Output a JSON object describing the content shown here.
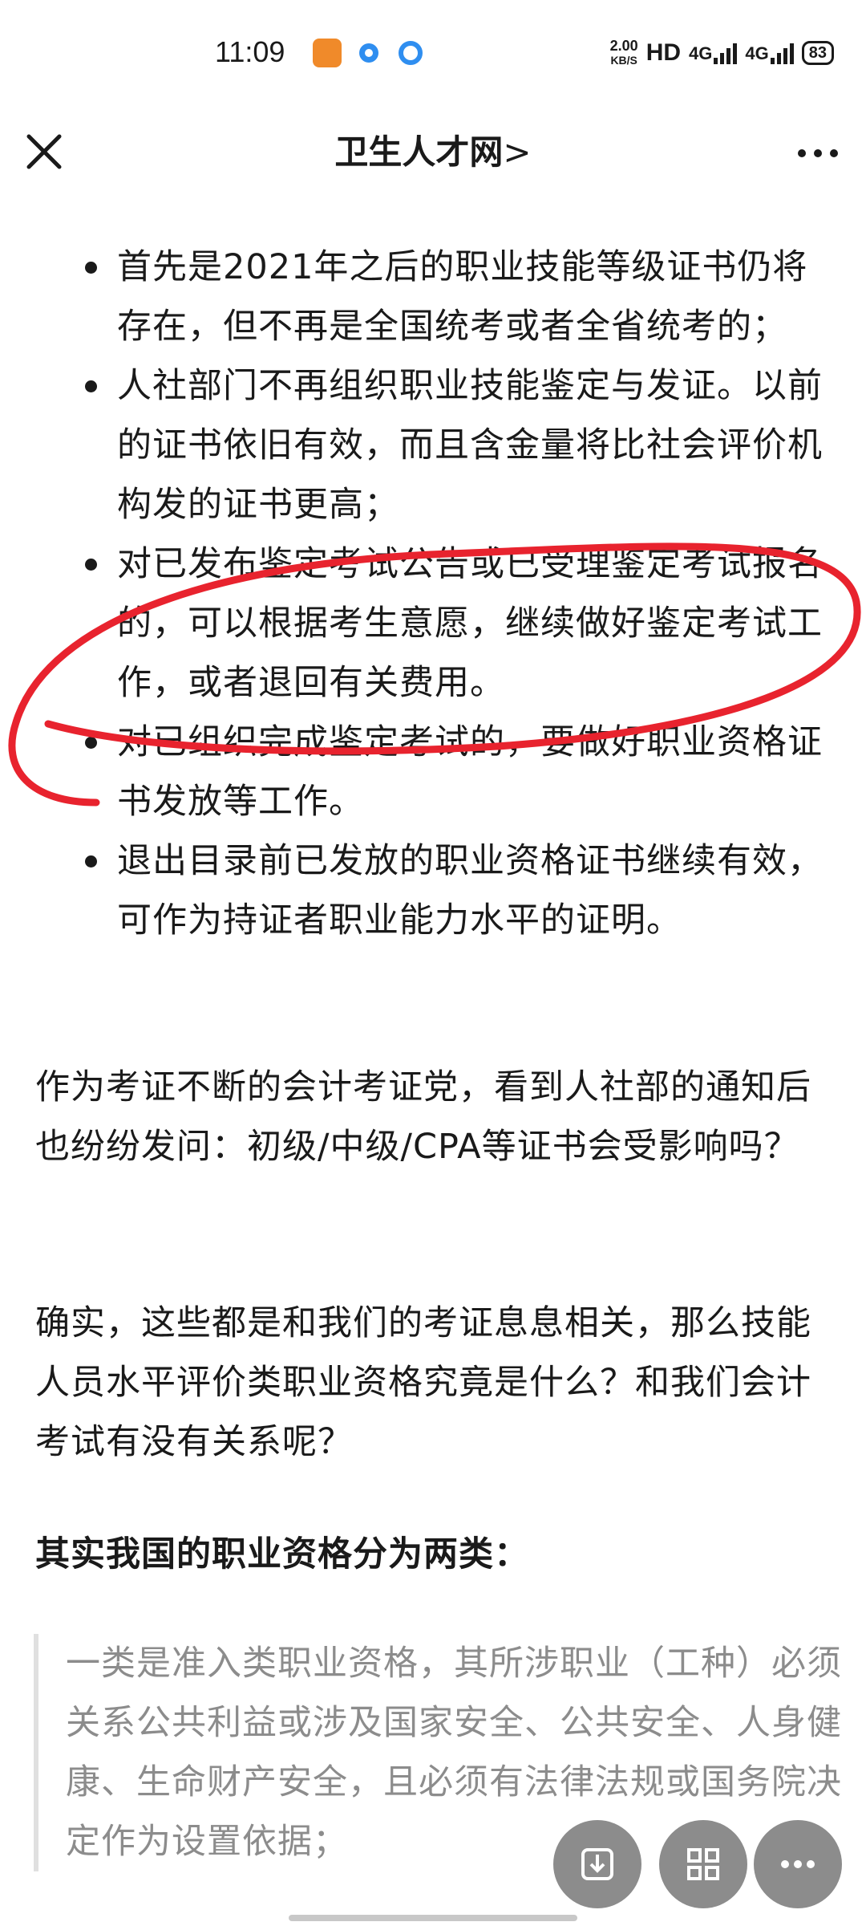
{
  "status_bar": {
    "time": "11:09",
    "net_speed_value": "2.00",
    "net_speed_unit": "KB/S",
    "hd_label": "HD",
    "signal1_label": "4G",
    "signal2_label": "4G",
    "battery": "83",
    "app_icons": [
      "uc-browser-icon",
      "blue-dot-icon",
      "qq-browser-icon"
    ]
  },
  "nav": {
    "title": "卫生人才网",
    "chevron": ">"
  },
  "article": {
    "bullets": [
      "首先是2021年之后的职业技能等级证书仍将存在，但不再是全国统考或者全省统考的；",
      "人社部门不再组织职业技能鉴定与发证。以前的证书依旧有效，而且含金量将比社会评价机构发的证书更高；",
      "对已发布鉴定考试公告或已受理鉴定考试报名的，可以根据考生意愿，继续做好鉴定考试工作，或者退回有关费用。",
      "对已组织完成鉴定考试的，要做好职业资格证书发放等工作。",
      "退出目录前已发放的职业资格证书继续有效，可作为持证者职业能力水平的证明。"
    ],
    "para1": "作为考证不断的会计考证党，看到人社部的通知后也纷纷发问：初级/中级/CPA等证书会受影响吗？",
    "para2": "确实，这些都是和我们的考证息息相关，那么技能人员水平评价类职业资格究竟是什么？和我们会计考试有没有关系呢？",
    "para3": "其实我国的职业资格分为两类：",
    "quote": "一类是准入类职业资格，其所涉职业（工种）必须关系公共利益或涉及国家安全、公共安全、人身健康、生命财产安全，且必须有法律法规或国务院决定作为设置依据；"
  },
  "colors": {
    "annotation": "#e8232e",
    "quote_text": "#8c8c8c",
    "fab": "#787878"
  }
}
